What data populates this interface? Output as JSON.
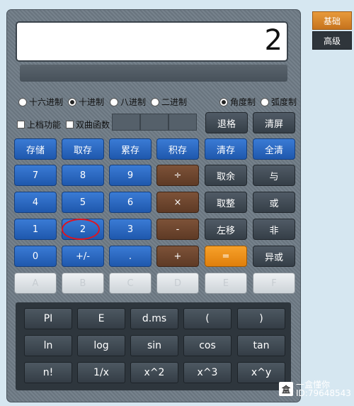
{
  "display": {
    "value": "2"
  },
  "tabs": {
    "basic": "基础",
    "advanced": "高级"
  },
  "radix": [
    {
      "label": "十六进制",
      "on": false
    },
    {
      "label": "十进制",
      "on": true
    },
    {
      "label": "八进制",
      "on": false
    },
    {
      "label": "二进制",
      "on": false
    }
  ],
  "angle": [
    {
      "label": "角度制",
      "on": true
    },
    {
      "label": "弧度制",
      "on": false
    }
  ],
  "checks": {
    "shift": "上档功能",
    "hyper": "双曲函数"
  },
  "buttons": {
    "backspace": "退格",
    "clear_screen": "清屏",
    "mem_store": "存储",
    "mem_recall": "取存",
    "mem_add": "累存",
    "mem_mul": "积存",
    "mem_clear": "清存",
    "clear_all": "全清",
    "n7": "7",
    "n8": "8",
    "n9": "9",
    "div": "÷",
    "mod": "取余",
    "and": "与",
    "n4": "4",
    "n5": "5",
    "n6": "6",
    "mul": "×",
    "int": "取整",
    "or": "或",
    "n1": "1",
    "n2": "2",
    "n3": "3",
    "sub": "-",
    "lsh": "左移",
    "not": "非",
    "n0": "0",
    "neg": "+/-",
    "dot": ".",
    "add": "+",
    "eq": "=",
    "xor": "异或",
    "hexA": "A",
    "hexB": "B",
    "hexC": "C",
    "hexD": "D",
    "hexE": "E",
    "hexF": "F"
  },
  "sci": [
    "PI",
    "E",
    "d.ms",
    "(",
    ")",
    "ln",
    "log",
    "sin",
    "cos",
    "tan",
    "n!",
    "1/x",
    "x^2",
    "x^3",
    "x^y"
  ],
  "watermark": {
    "site": "一盒懂你",
    "id": "ID:79648543"
  }
}
